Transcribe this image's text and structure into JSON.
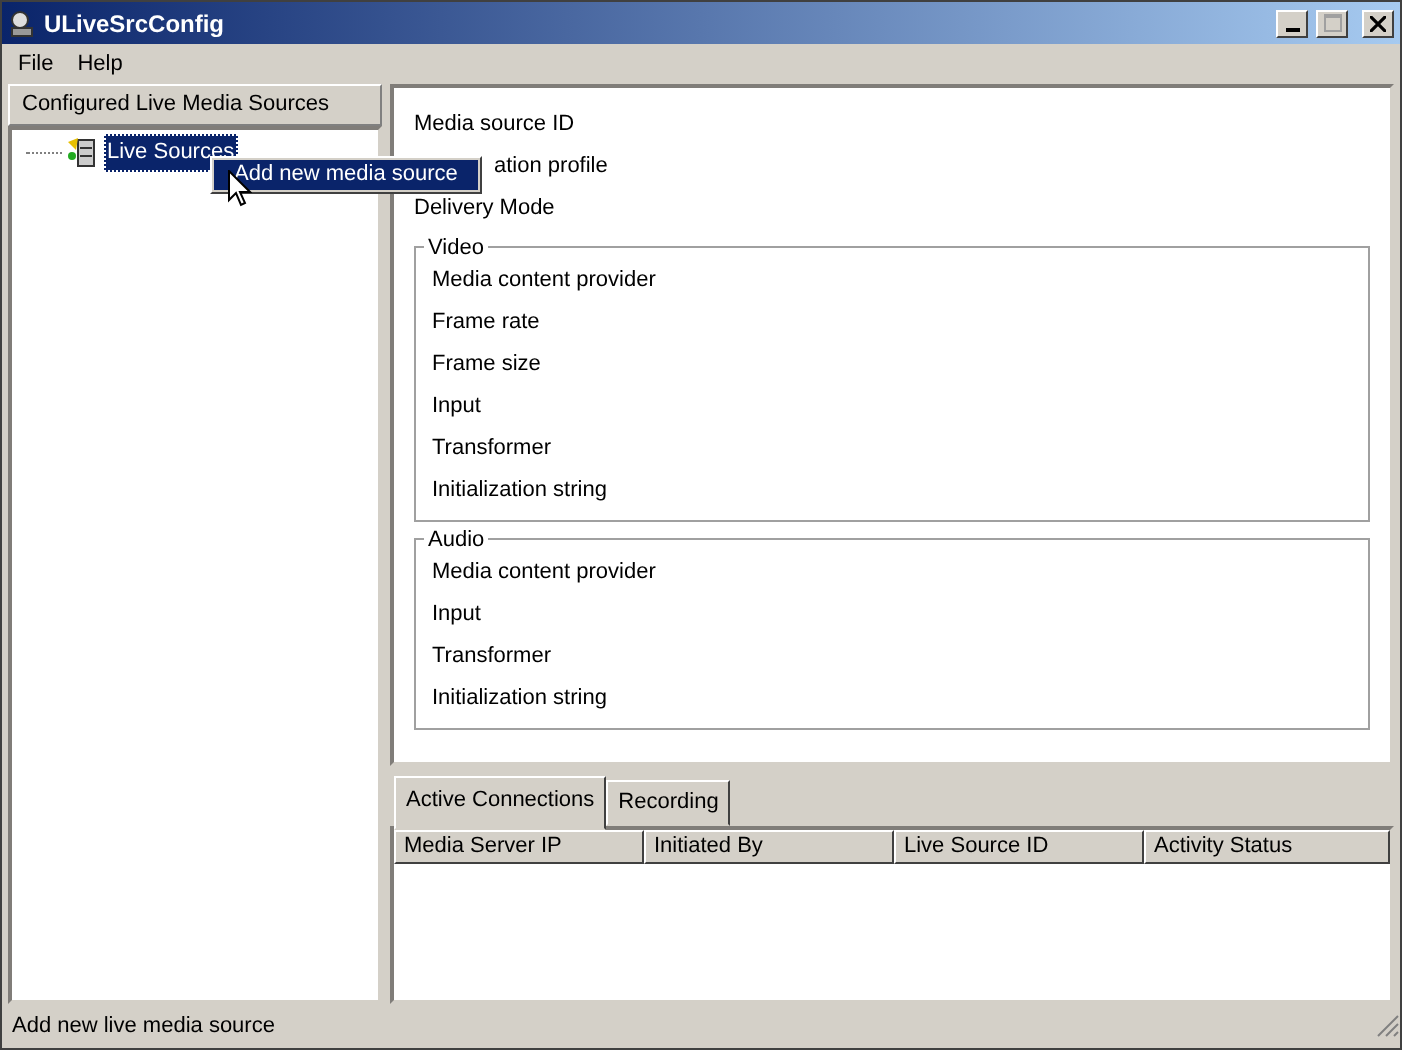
{
  "window": {
    "title": "ULiveSrcConfig"
  },
  "menu": [
    "File",
    "Help"
  ],
  "sidebar": {
    "header": "Configured Live Media Sources",
    "tree": [
      {
        "label": "Live Sources",
        "selected": true
      }
    ]
  },
  "context_menu": {
    "items": [
      {
        "label": "Add new media source",
        "selected": true
      }
    ]
  },
  "properties": {
    "fields": [
      "Media source ID",
      "ation profile",
      "Delivery Mode"
    ],
    "groups": [
      {
        "title": "Video",
        "fields": [
          "Media content provider",
          "Frame rate",
          "Frame size",
          "Input",
          "Transformer",
          "Initialization string"
        ]
      },
      {
        "title": "Audio",
        "fields": [
          "Media content provider",
          "Input",
          "Transformer",
          "Initialization string"
        ]
      }
    ]
  },
  "tabs": [
    {
      "label": "Active Connections",
      "selected": true
    },
    {
      "label": "Recording",
      "selected": false
    }
  ],
  "table": {
    "columns": [
      "Media Server IP",
      "Initiated By",
      "Live Source ID",
      "Activity Status"
    ]
  },
  "status_bar": "Add new live media source"
}
